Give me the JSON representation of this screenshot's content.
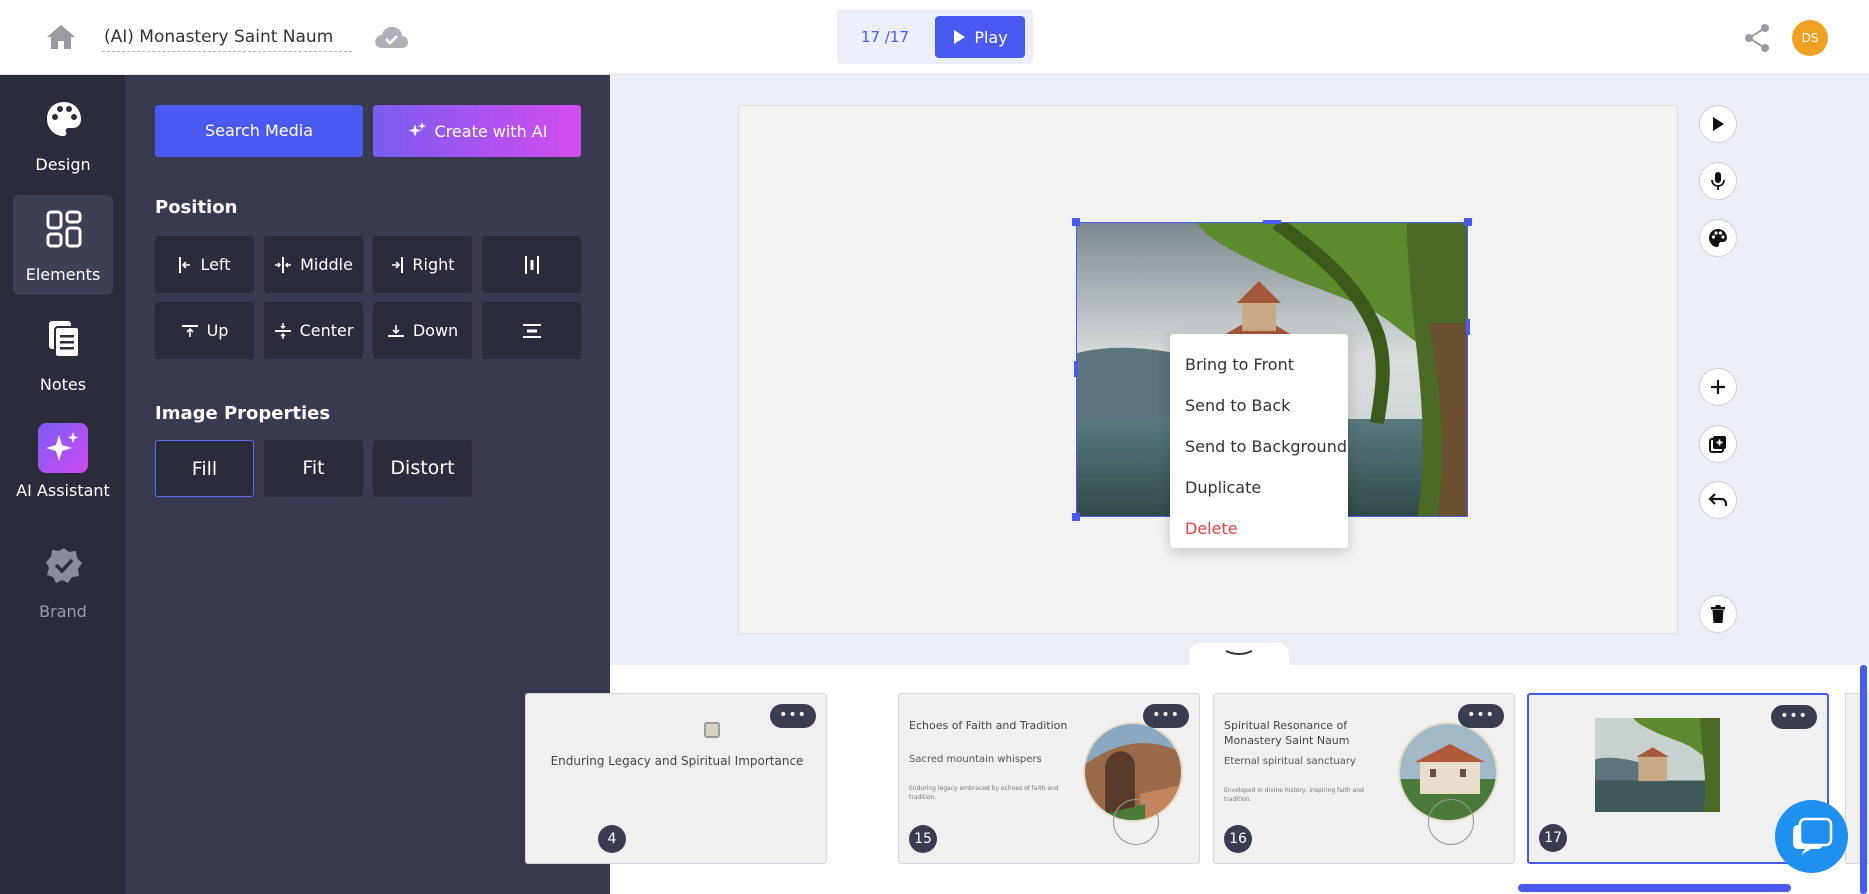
{
  "topbar": {
    "doc_title": "(AI) Monastery Saint Naum",
    "slide_counter": "17 /17",
    "play_label": "Play",
    "avatar_initials": "DS"
  },
  "rail": {
    "design": "Design",
    "elements": "Elements",
    "notes": "Notes",
    "ai_assistant": "AI Assistant",
    "brand": "Brand"
  },
  "panel": {
    "search_media": "Search Media",
    "create_ai": "Create with AI",
    "position_title": "Position",
    "left": "Left",
    "middle": "Middle",
    "right": "Right",
    "up": "Up",
    "center": "Center",
    "down": "Down",
    "image_props_title": "Image Properties",
    "fill": "Fill",
    "fit": "Fit",
    "distort": "Distort"
  },
  "context_menu": {
    "bring_front": "Bring to Front",
    "send_back": "Send to Back",
    "send_background": "Send to Background",
    "duplicate": "Duplicate",
    "delete": "Delete"
  },
  "filmstrip": {
    "menu_glyph": "•••",
    "slide14": {
      "num": "4",
      "title": "Enduring Legacy and Spiritual Importance"
    },
    "slide15": {
      "num": "15",
      "title": "Echoes of Faith and Tradition",
      "sub": "Sacred mountain whispers",
      "tiny": "Enduring legacy embraced by echoes of faith and tradition."
    },
    "slide16": {
      "num": "16",
      "title": "Spiritual Resonance of Monastery Saint Naum",
      "sub": "Eternal spiritual sanctuary",
      "tiny": "Enveloped in divine history, inspiring faith and tradition."
    },
    "slide17": {
      "num": "17"
    }
  },
  "colors": {
    "accent": "#4a5af0",
    "danger": "#e84040",
    "rail_bg": "#2a2b3b",
    "panel_bg": "#383a50"
  }
}
